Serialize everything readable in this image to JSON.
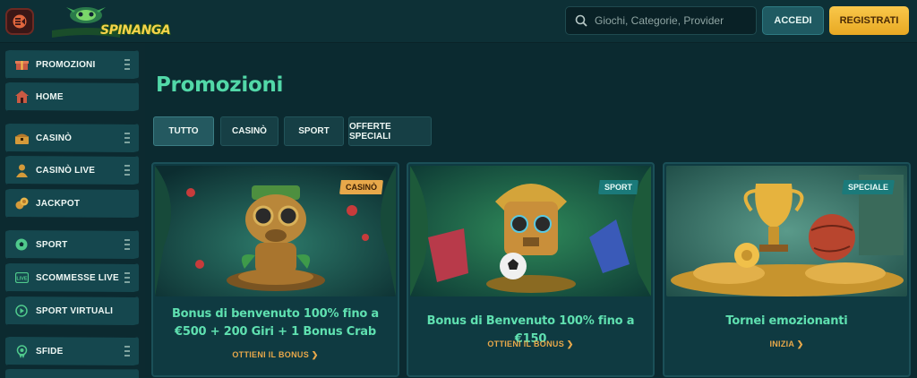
{
  "header": {
    "logo_text": "SPINANGA",
    "search_placeholder": "Giochi, Categorie, Provider",
    "login_label": "ACCEDI",
    "register_label": "REGISTRATI"
  },
  "sidebar": {
    "items": [
      {
        "label": "PROMOZIONI",
        "icon": "gift-icon"
      },
      {
        "label": "HOME",
        "icon": "home-icon"
      },
      {
        "label": "CASINÒ",
        "icon": "treasure-chest-icon"
      },
      {
        "label": "CASINÒ LIVE",
        "icon": "dealer-icon"
      },
      {
        "label": "JACKPOT",
        "icon": "coins-icon"
      },
      {
        "label": "SPORT",
        "icon": "soccer-ball-icon"
      },
      {
        "label": "SCOMMESSE LIVE",
        "icon": "live-icon"
      },
      {
        "label": "SPORT VIRTUALI",
        "icon": "virtual-sport-icon"
      },
      {
        "label": "SFIDE",
        "icon": "medal-icon"
      }
    ]
  },
  "main": {
    "title": "Promozioni",
    "tabs": [
      {
        "label": "TUTTO",
        "active": true
      },
      {
        "label": "CASINÒ",
        "active": false
      },
      {
        "label": "SPORT",
        "active": false
      },
      {
        "label": "OFFERTE SPECIALI",
        "active": false
      }
    ],
    "cards": [
      {
        "badge": "CASINÒ",
        "title": "Bonus di benvenuto 100% fino a €500 + 200 Giri + 1 Bonus Crab",
        "cta": "OTTIENI IL BONUS ❯"
      },
      {
        "badge": "SPORT",
        "title": "Bonus di Benvenuto 100% fino a €150",
        "cta": "OTTIENI IL BONUS ❯"
      },
      {
        "badge": "SPECIALE",
        "title": "Tornei emozionanti",
        "cta": "INIZIA ❯"
      }
    ]
  },
  "colors": {
    "accent_green": "#52d8a8",
    "accent_gold": "#e8a84a",
    "background": "#0b2a30"
  }
}
